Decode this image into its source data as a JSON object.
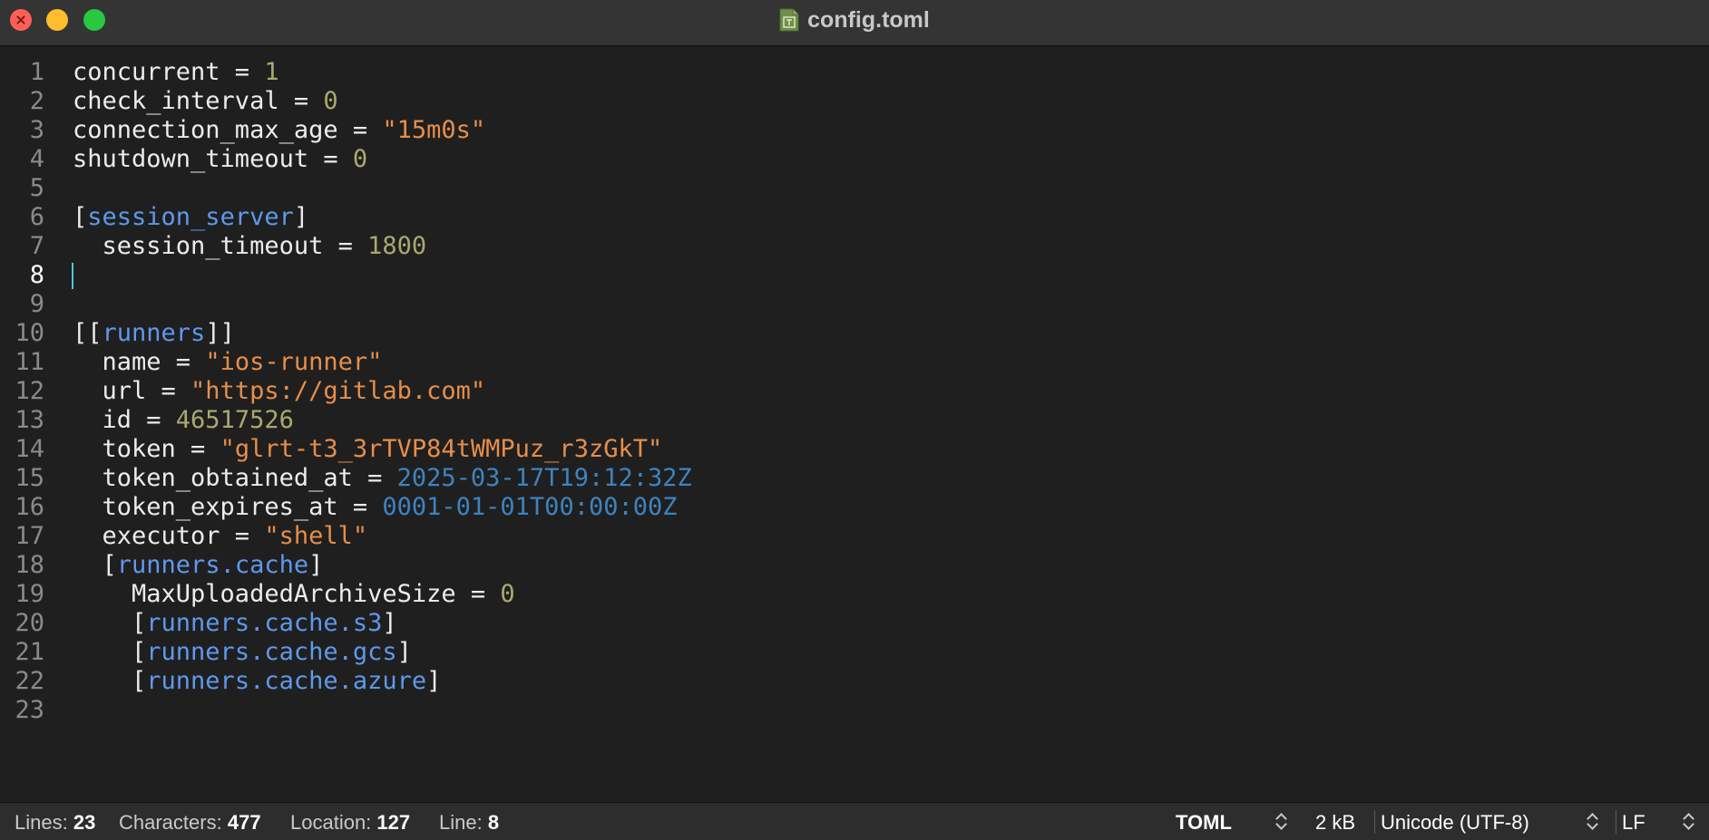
{
  "window": {
    "title": "config.toml",
    "file_icon": "toml-file-icon",
    "colors": {
      "close": "#ff5f57",
      "minimize": "#febc2e",
      "maximize": "#28c840"
    }
  },
  "editor": {
    "current_line": 8,
    "lines": [
      {
        "n": "1",
        "tokens": [
          {
            "t": "concurrent = ",
            "k": "plain"
          },
          {
            "t": "1",
            "k": "number"
          }
        ]
      },
      {
        "n": "2",
        "tokens": [
          {
            "t": "check_interval = ",
            "k": "plain"
          },
          {
            "t": "0",
            "k": "number"
          }
        ]
      },
      {
        "n": "3",
        "tokens": [
          {
            "t": "connection_max_age = ",
            "k": "plain"
          },
          {
            "t": "\"15m0s\"",
            "k": "string"
          }
        ]
      },
      {
        "n": "4",
        "tokens": [
          {
            "t": "shutdown_timeout = ",
            "k": "plain"
          },
          {
            "t": "0",
            "k": "number"
          }
        ]
      },
      {
        "n": "5",
        "tokens": []
      },
      {
        "n": "6",
        "tokens": [
          {
            "t": "[",
            "k": "plain"
          },
          {
            "t": "session_server",
            "k": "table"
          },
          {
            "t": "]",
            "k": "plain"
          }
        ]
      },
      {
        "n": "7",
        "tokens": [
          {
            "t": "  session_timeout = ",
            "k": "plain"
          },
          {
            "t": "1800",
            "k": "number"
          }
        ]
      },
      {
        "n": "8",
        "tokens": []
      },
      {
        "n": "9",
        "tokens": []
      },
      {
        "n": "10",
        "tokens": [
          {
            "t": "[[",
            "k": "plain"
          },
          {
            "t": "runners",
            "k": "table"
          },
          {
            "t": "]]",
            "k": "plain"
          }
        ]
      },
      {
        "n": "11",
        "tokens": [
          {
            "t": "  name = ",
            "k": "plain"
          },
          {
            "t": "\"ios-runner\"",
            "k": "string"
          }
        ]
      },
      {
        "n": "12",
        "tokens": [
          {
            "t": "  url = ",
            "k": "plain"
          },
          {
            "t": "\"https://gitlab.com\"",
            "k": "string"
          }
        ]
      },
      {
        "n": "13",
        "tokens": [
          {
            "t": "  id = ",
            "k": "plain"
          },
          {
            "t": "46517526",
            "k": "number"
          }
        ]
      },
      {
        "n": "14",
        "tokens": [
          {
            "t": "  token = ",
            "k": "plain"
          },
          {
            "t": "\"glrt-t3_3rTVP84tWMPuz_r3zGkT\"",
            "k": "string"
          }
        ]
      },
      {
        "n": "15",
        "tokens": [
          {
            "t": "  token_obtained_at = ",
            "k": "plain"
          },
          {
            "t": "2025-03-17T19:12:32Z",
            "k": "date"
          }
        ]
      },
      {
        "n": "16",
        "tokens": [
          {
            "t": "  token_expires_at = ",
            "k": "plain"
          },
          {
            "t": "0001-01-01T00:00:00Z",
            "k": "date"
          }
        ]
      },
      {
        "n": "17",
        "tokens": [
          {
            "t": "  executor = ",
            "k": "plain"
          },
          {
            "t": "\"shell\"",
            "k": "string"
          }
        ]
      },
      {
        "n": "18",
        "tokens": [
          {
            "t": "  [",
            "k": "plain"
          },
          {
            "t": "runners.cache",
            "k": "table"
          },
          {
            "t": "]",
            "k": "plain"
          }
        ]
      },
      {
        "n": "19",
        "tokens": [
          {
            "t": "    MaxUploadedArchiveSize = ",
            "k": "plain"
          },
          {
            "t": "0",
            "k": "number"
          }
        ]
      },
      {
        "n": "20",
        "tokens": [
          {
            "t": "    [",
            "k": "plain"
          },
          {
            "t": "runners.cache.s3",
            "k": "table"
          },
          {
            "t": "]",
            "k": "plain"
          }
        ]
      },
      {
        "n": "21",
        "tokens": [
          {
            "t": "    [",
            "k": "plain"
          },
          {
            "t": "runners.cache.gcs",
            "k": "table"
          },
          {
            "t": "]",
            "k": "plain"
          }
        ]
      },
      {
        "n": "22",
        "tokens": [
          {
            "t": "    [",
            "k": "plain"
          },
          {
            "t": "runners.cache.azure",
            "k": "table"
          },
          {
            "t": "]",
            "k": "plain"
          }
        ]
      },
      {
        "n": "23",
        "tokens": []
      }
    ],
    "syntax_colors": {
      "plain": "#ececec",
      "number": "#a9a96e",
      "string": "#e68e4a",
      "table": "#5f98ec",
      "date": "#3d83c0",
      "cursor": "#4fc6e0"
    }
  },
  "statusbar": {
    "lines_label": "Lines:",
    "lines_value": "23",
    "chars_label": "Characters:",
    "chars_value": "477",
    "location_label": "Location:",
    "location_value": "127",
    "line_label": "Line:",
    "line_value": "8",
    "language": "TOML",
    "file_size": "2 kB",
    "encoding": "Unicode (UTF-8)",
    "line_endings": "LF"
  }
}
